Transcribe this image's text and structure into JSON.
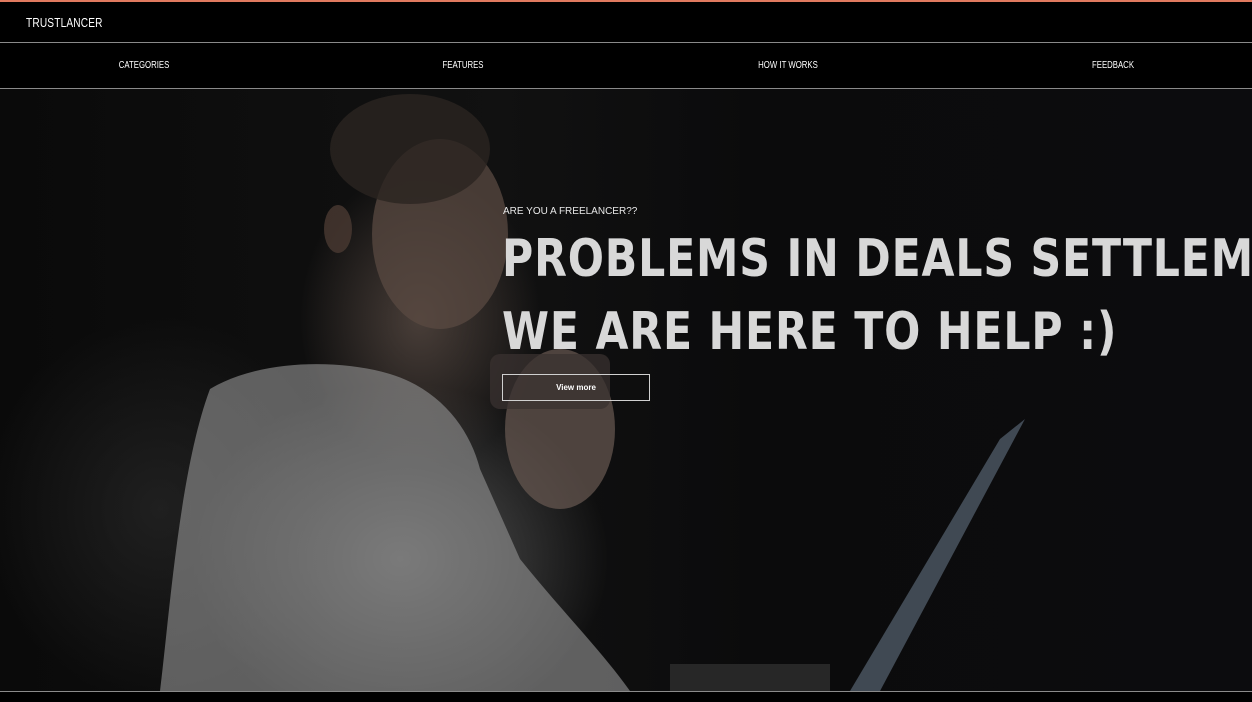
{
  "brand": {
    "name": "TRUSTLANCER"
  },
  "nav": {
    "items": [
      {
        "label": "CATEGORIES"
      },
      {
        "label": "FEATURES"
      },
      {
        "label": "HOW IT WORKS"
      },
      {
        "label": "FEEDBACK"
      }
    ]
  },
  "hero": {
    "eyebrow": "ARE YOU A FREELANCER??",
    "headline_line1": "PROBLEMS IN DEALS SETTLEMENT?",
    "headline_line2": "WE ARE HERE TO HELP :)",
    "cta_label": "View more"
  },
  "colors": {
    "top_accent": "#e07a5f",
    "background": "#000000",
    "headline": "#d8d8d8"
  }
}
